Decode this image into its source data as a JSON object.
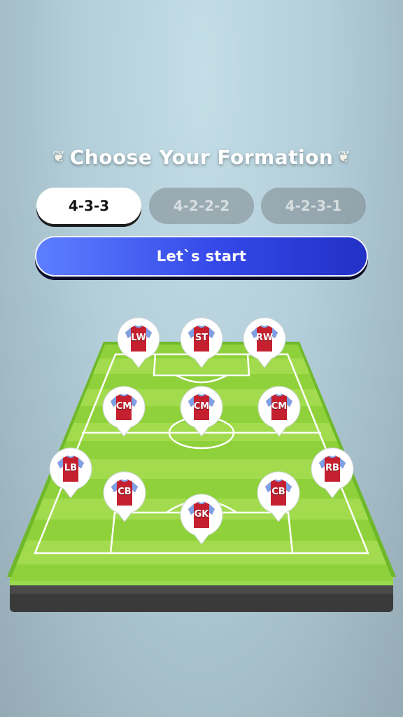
{
  "header": {
    "title": "Choose Your Formation"
  },
  "formation_tabs": [
    {
      "label": "4-3-3",
      "selected": true
    },
    {
      "label": "4-2-2-2",
      "selected": false
    },
    {
      "label": "4-2-3-1",
      "selected": false
    }
  ],
  "start_button": {
    "label": "Let`s start"
  },
  "pitch": {
    "positions": [
      {
        "label": "LW"
      },
      {
        "label": "ST"
      },
      {
        "label": "RW"
      },
      {
        "label": "CM"
      },
      {
        "label": "CM"
      },
      {
        "label": "CM"
      },
      {
        "label": "LB"
      },
      {
        "label": "CB"
      },
      {
        "label": "CB"
      },
      {
        "label": "RB"
      },
      {
        "label": "GK"
      }
    ]
  },
  "colors": {
    "accent_blue": "#3448e8",
    "pitch_green": "#8fd13a",
    "jersey_red": "#c4202f",
    "jersey_sleeve": "#7ea0e6"
  }
}
